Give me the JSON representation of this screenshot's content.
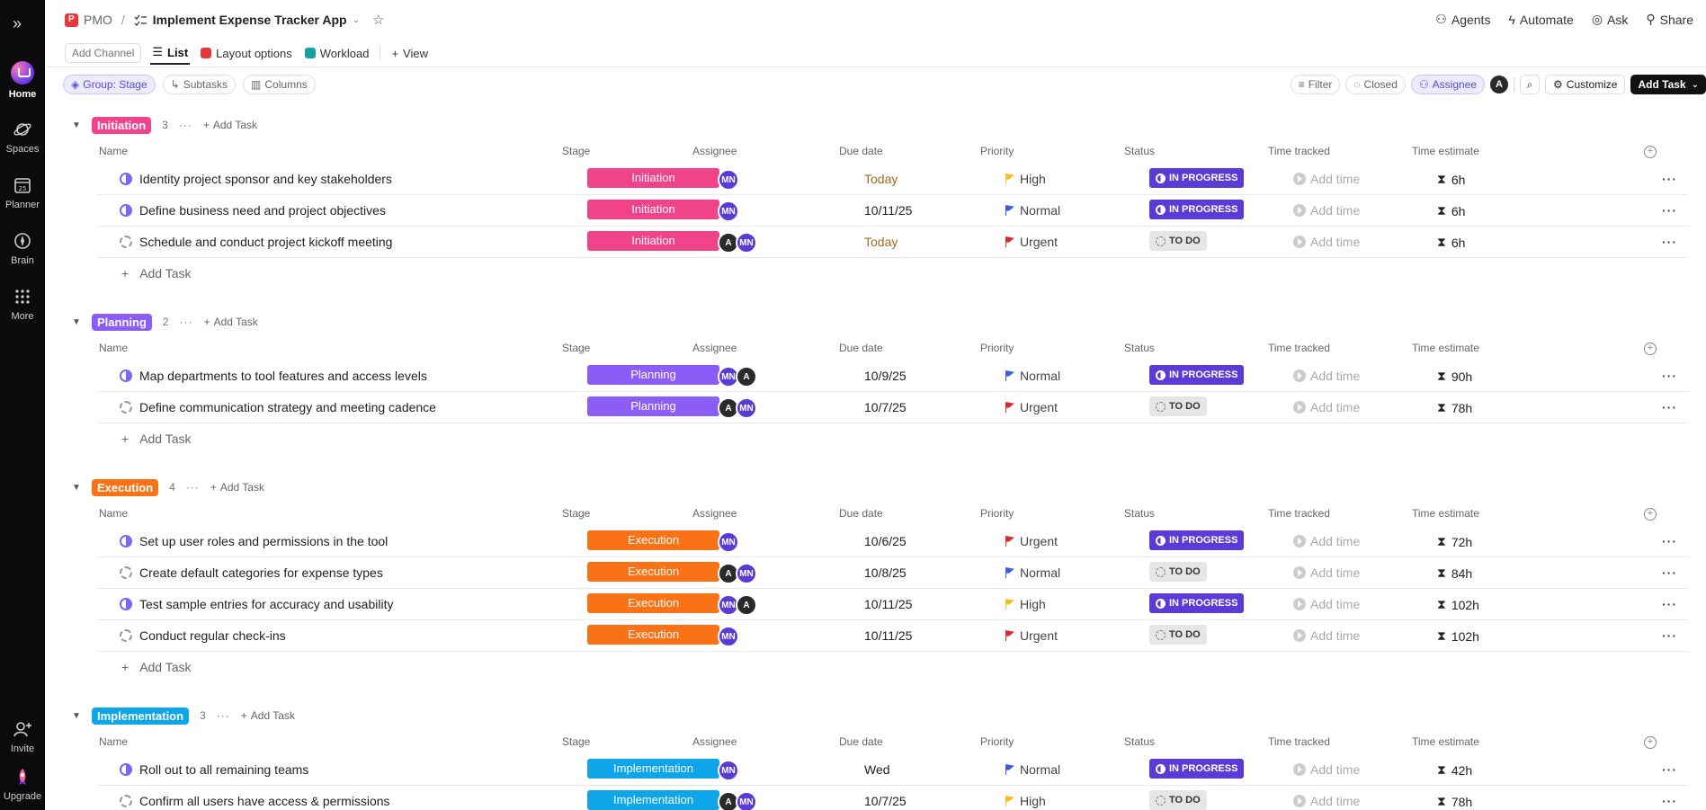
{
  "rail": {
    "items": [
      {
        "label": "Home"
      },
      {
        "label": "Spaces"
      },
      {
        "label": "Planner"
      },
      {
        "label": "Brain"
      },
      {
        "label": "More"
      },
      {
        "label": "Invite"
      },
      {
        "label": "Upgrade"
      }
    ]
  },
  "breadcrumb": {
    "space": "PMO",
    "sep": "/",
    "list": "Implement Expense Tracker App"
  },
  "topright": {
    "agents": "Agents",
    "automate": "Automate",
    "ask": "Ask",
    "share": "Share"
  },
  "viewbar": {
    "add_channel": "Add Channel",
    "list": "List",
    "layout_options": "Layout options",
    "workload": "Workload",
    "view": "View"
  },
  "toolbar": {
    "group": "Group: Stage",
    "subtasks": "Subtasks",
    "columns": "Columns",
    "filter": "Filter",
    "closed": "Closed",
    "assignee": "Assignee",
    "avatar": "A",
    "customize": "Customize",
    "add_task": "Add Task"
  },
  "columns": {
    "name": "Name",
    "stage": "Stage",
    "assignee": "Assignee",
    "due": "Due date",
    "priority": "Priority",
    "status": "Status",
    "time_tracked": "Time tracked",
    "time_estimate": "Time estimate"
  },
  "add_task_label": "Add Task",
  "add_time_label": "Add time",
  "groups": [
    {
      "name": "Initiation",
      "count": "3",
      "color": "#f0438a",
      "tasks": [
        {
          "name": "Identity project sponsor and key stakeholders",
          "stage": "Initiation",
          "assignees": [
            "MN"
          ],
          "due": "Today",
          "priority": "High",
          "status": "IN PROGRESS",
          "estimate": "6h"
        },
        {
          "name": "Define business need and project objectives",
          "stage": "Initiation",
          "assignees": [
            "MN"
          ],
          "due": "10/11/25",
          "priority": "Normal",
          "status": "IN PROGRESS",
          "estimate": "6h"
        },
        {
          "name": "Schedule and conduct project kickoff meeting",
          "stage": "Initiation",
          "assignees": [
            "A",
            "MN"
          ],
          "due": "Today",
          "priority": "Urgent",
          "status": "TO DO",
          "estimate": "6h"
        }
      ]
    },
    {
      "name": "Planning",
      "count": "2",
      "color": "#8b5cf6",
      "tasks": [
        {
          "name": "Map departments to tool features and access levels",
          "stage": "Planning",
          "assignees": [
            "MN",
            "A"
          ],
          "due": "10/9/25",
          "priority": "Normal",
          "status": "IN PROGRESS",
          "estimate": "90h"
        },
        {
          "name": "Define communication strategy and meeting cadence",
          "stage": "Planning",
          "assignees": [
            "A",
            "MN"
          ],
          "due": "10/7/25",
          "priority": "Urgent",
          "status": "TO DO",
          "estimate": "78h"
        }
      ]
    },
    {
      "name": "Execution",
      "count": "4",
      "color": "#f97316",
      "tasks": [
        {
          "name": "Set up user roles and permissions in the tool",
          "stage": "Execution",
          "assignees": [
            "MN"
          ],
          "due": "10/6/25",
          "priority": "Urgent",
          "status": "IN PROGRESS",
          "estimate": "72h"
        },
        {
          "name": "Create default categories for expense types",
          "stage": "Execution",
          "assignees": [
            "A",
            "MN"
          ],
          "due": "10/8/25",
          "priority": "Normal",
          "status": "TO DO",
          "estimate": "84h"
        },
        {
          "name": "Test sample entries for accuracy and usability",
          "stage": "Execution",
          "assignees": [
            "MN",
            "A"
          ],
          "due": "10/11/25",
          "priority": "High",
          "status": "IN PROGRESS",
          "estimate": "102h"
        },
        {
          "name": "Conduct regular check-ins",
          "stage": "Execution",
          "assignees": [
            "MN"
          ],
          "due": "10/11/25",
          "priority": "Urgent",
          "status": "TO DO",
          "estimate": "102h"
        }
      ]
    },
    {
      "name": "Implementation",
      "count": "3",
      "color": "#0ea5e9",
      "tasks": [
        {
          "name": "Roll out to all remaining teams",
          "stage": "Implementation",
          "assignees": [
            "MN"
          ],
          "due": "Wed",
          "priority": "Normal",
          "status": "IN PROGRESS",
          "estimate": "42h"
        },
        {
          "name": "Confirm all users have access & permissions",
          "stage": "Implementation",
          "assignees": [
            "A",
            "MN"
          ],
          "due": "10/7/25",
          "priority": "High",
          "status": "TO DO",
          "estimate": "78h"
        }
      ]
    }
  ],
  "colors": {
    "urgent": "#d32f2f",
    "high": "#f6c026",
    "normal": "#3f5fd8",
    "in_progress": "#5b3bd6"
  }
}
